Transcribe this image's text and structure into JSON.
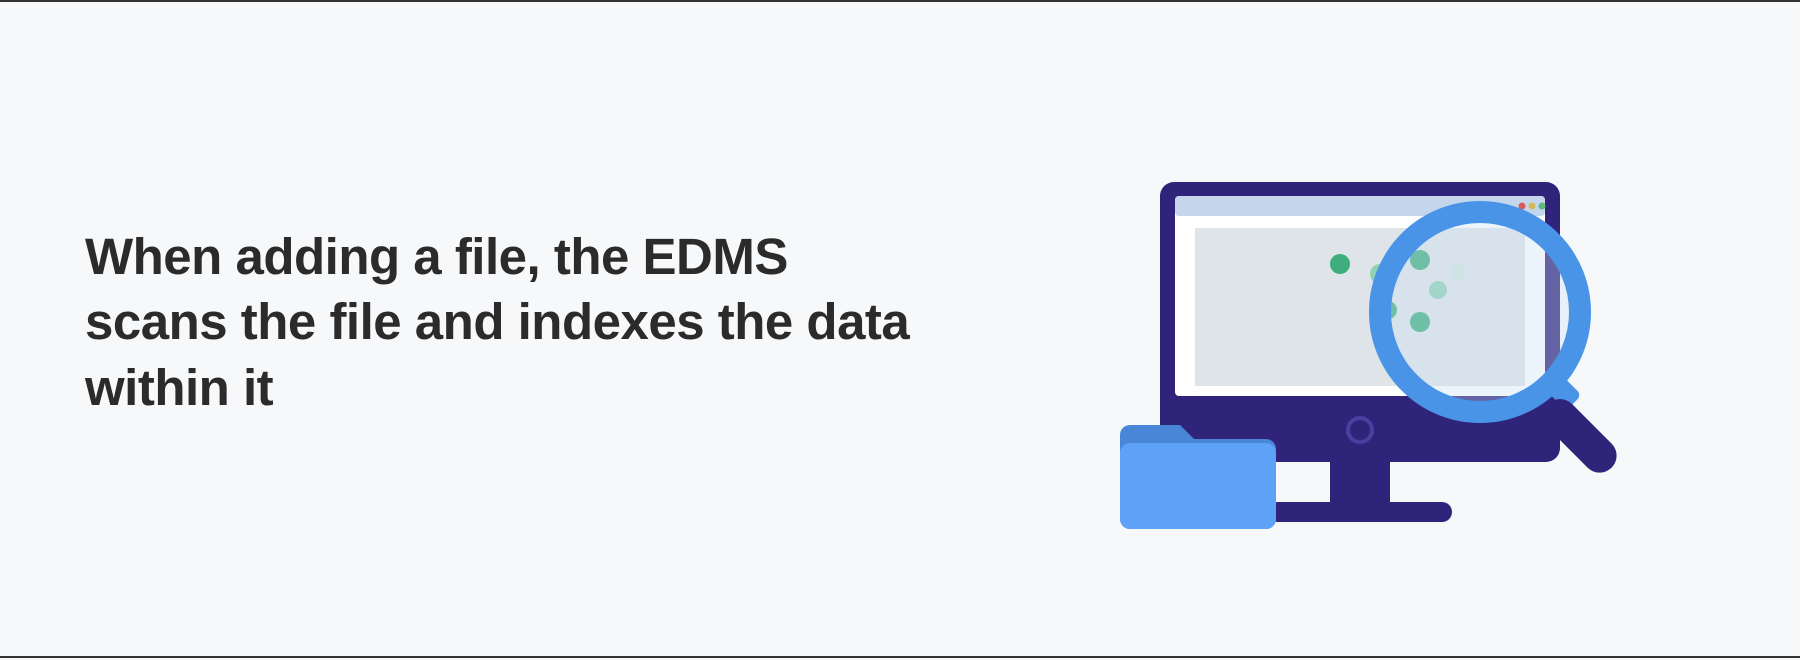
{
  "headline": "When adding a file, the EDMS scans the file and indexes the data within it",
  "illustration": {
    "name": "edms-scan-illustration",
    "semantic_parts": [
      "computer-monitor-icon",
      "folder-icon",
      "magnifying-glass-icon",
      "browser-window-dots",
      "data-dots"
    ]
  },
  "colors": {
    "page_bg": "#f7f8fa",
    "text": "#2b2b2b",
    "monitor_bezel": "#2f237a",
    "monitor_screen": "#ffffff",
    "titlebar": "#c3d6ec",
    "content_panel": "#dfe4e9",
    "folder": "#5ea2f7",
    "magnifier": "#4a94e8",
    "handle": "#2f237a",
    "dot_green": "#3fae7d",
    "dot_green_light": "#8fd1b1",
    "traffic_red": "#d85c5c",
    "traffic_yellow": "#d8b85c",
    "traffic_green": "#5cb97a"
  }
}
